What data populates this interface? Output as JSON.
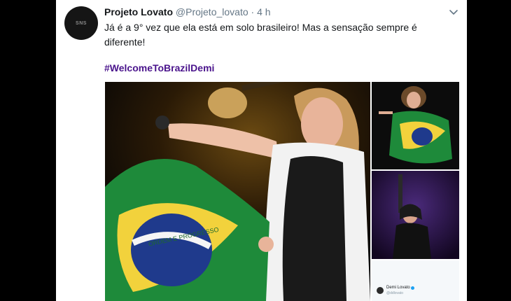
{
  "tweet": {
    "avatar_text": "SNS",
    "display_name": "Projeto Lovato",
    "handle": "@Projeto_lovato",
    "separator": "·",
    "time": "4 h",
    "text": "Já é a 9° vez que ela está em solo brasileiro! Mas a sensação sempre é diferente!",
    "hashtag": "#WelcomeToBrazilDemi"
  },
  "media": {
    "main_flag_motto": "ORDEM E PROGRESSO",
    "embedded_tweet": {
      "name": "Demi Lovato",
      "handle": "@ddlovato"
    }
  },
  "colors": {
    "page_bg": "#000000",
    "card_bg": "#ffffff",
    "text": "#14171a",
    "secondary_text": "#657786",
    "hashtag": "#4a148c"
  },
  "icons": {
    "menu": "chevron-down-icon",
    "verified": "verified-badge-icon"
  }
}
